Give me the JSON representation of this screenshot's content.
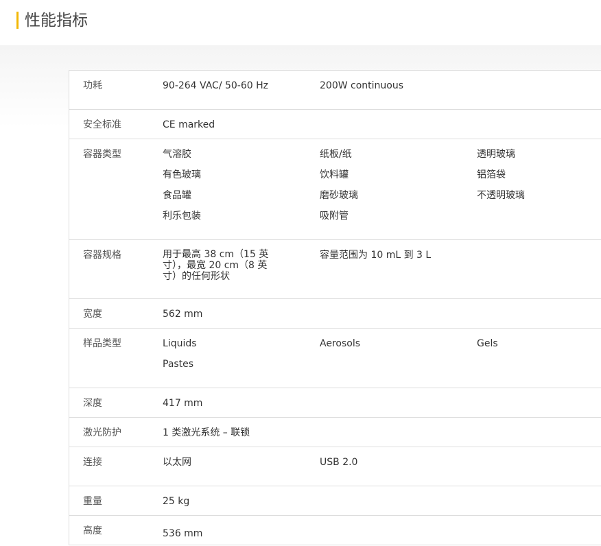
{
  "page_title": "性能指标",
  "colors": {
    "accent": "#f2b705",
    "border": "#dddddd",
    "text": "#333333"
  },
  "specs": {
    "power": {
      "label": "功耗",
      "values": [
        "90-264 VAC/ 50-60 Hz",
        "200W continuous"
      ]
    },
    "safety": {
      "label": "安全标准",
      "values": [
        "CE marked"
      ]
    },
    "container_types": {
      "label": "容器类型",
      "values": [
        "气溶胶",
        "纸板/纸",
        "透明玻璃",
        "有色玻璃",
        "饮料罐",
        "铝箔袋",
        "食品罐",
        "磨砂玻璃",
        "不透明玻璃",
        "利乐包装",
        "吸附管"
      ]
    },
    "container_size": {
      "label": "容器规格",
      "values": [
        "用于最高 38 cm（15 英寸），最宽 20 cm（8 英寸）的任何形状",
        "容量范围为 10 mL 到 3 L"
      ]
    },
    "width": {
      "label": "宽度",
      "values": [
        "562 mm"
      ]
    },
    "sample_types": {
      "label": "样品类型",
      "values": [
        "Liquids",
        "Aerosols",
        "Gels",
        "Pastes"
      ]
    },
    "depth": {
      "label": "深度",
      "values": [
        "417 mm"
      ]
    },
    "laser": {
      "label": "激光防护",
      "values": [
        "1 类激光系统 – 联锁"
      ]
    },
    "connectivity": {
      "label": "连接",
      "values": [
        "以太网",
        "USB 2.0"
      ]
    },
    "weight": {
      "label": "重量",
      "values": [
        "25 kg"
      ]
    },
    "height": {
      "label": "高度",
      "values": [
        "536 mm"
      ]
    }
  }
}
